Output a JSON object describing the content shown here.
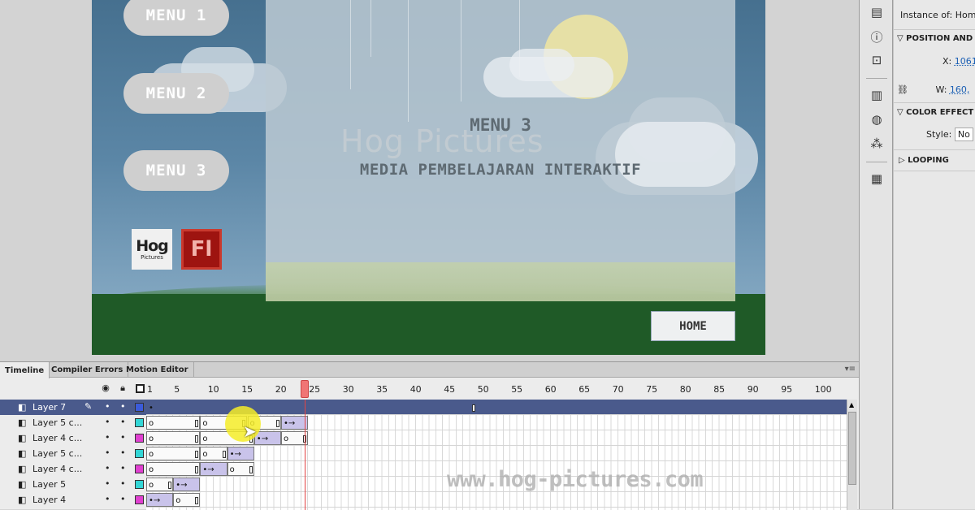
{
  "stage": {
    "menu_buttons": [
      "MENU 1",
      "MENU 2",
      "MENU 3"
    ],
    "logo_hog": {
      "main": "Hog",
      "sub": "Pictures"
    },
    "logo_fl": "Fl",
    "panel_title": "MENU 3",
    "panel_subtitle": "MEDIA PEMBELAJARAN INTERAKTIF",
    "watermark": "Hog Pictures",
    "home_button": "HOME"
  },
  "properties": {
    "instance_of_label": "Instance of:",
    "instance_of_value": "Hom",
    "position_header": "POSITION AND",
    "x_label": "X:",
    "x_value": "1061",
    "w_label": "W:",
    "w_value": "160,",
    "color_effect_header": "COLOR EFFECT",
    "style_label": "Style:",
    "style_value": "No",
    "looping_header": "LOOPING"
  },
  "timeline": {
    "tabs": [
      "Timeline",
      "Compiler Errors",
      "Motion Editor"
    ],
    "ruler_labels": [
      "1",
      "5",
      "10",
      "15",
      "20",
      "25",
      "30",
      "35",
      "40",
      "45",
      "50",
      "55",
      "60",
      "65",
      "70",
      "75",
      "80",
      "85",
      "90",
      "95",
      "100"
    ],
    "current_frame": 24,
    "layers": [
      {
        "name": "Layer 7",
        "color": "#3b5bdb",
        "selected": true
      },
      {
        "name": "Layer 5 c...",
        "color": "#33d6d6",
        "selected": false
      },
      {
        "name": "Layer 4 c...",
        "color": "#e040d0",
        "selected": false
      },
      {
        "name": "Layer 5 c...",
        "color": "#33d6d6",
        "selected": false
      },
      {
        "name": "Layer 4 c...",
        "color": "#e040d0",
        "selected": false
      },
      {
        "name": "Layer 5",
        "color": "#33d6d6",
        "selected": false
      },
      {
        "name": "Layer 4",
        "color": "#e040d0",
        "selected": false
      }
    ]
  },
  "watermark_site": "www.hog-pictures.com",
  "icons": [
    "eye-icon",
    "lock-icon",
    "outline-icon",
    "pencil-icon",
    "layer-icon",
    "cursor-arrow-icon",
    "align-icon",
    "info-icon",
    "transform-icon",
    "library-icon",
    "color-icon",
    "components-icon",
    "panel-menu-icon",
    "link-icon"
  ]
}
